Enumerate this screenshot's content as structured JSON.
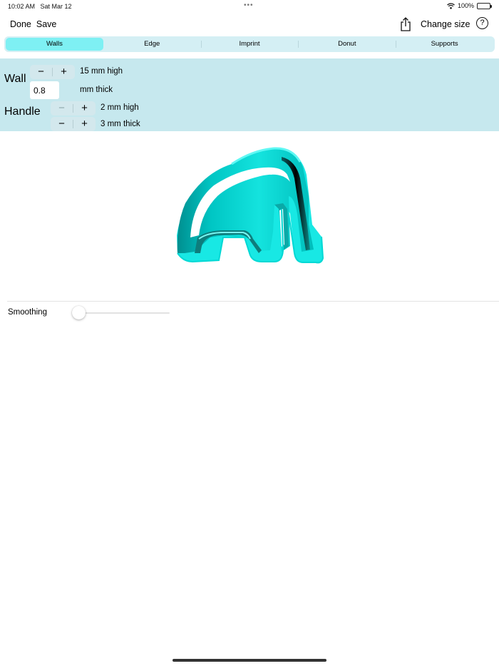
{
  "status_bar": {
    "time": "10:02 AM",
    "date": "Sat Mar 12",
    "dots": "•••",
    "battery": "100%",
    "battery_level": 1.0
  },
  "nav": {
    "done_label": "Done",
    "save_label": "Save",
    "change_size_label": "Change size",
    "help_label": "?"
  },
  "tabs": [
    {
      "label": "Walls",
      "active": true
    },
    {
      "label": "Edge",
      "active": false
    },
    {
      "label": "Imprint",
      "active": false
    },
    {
      "label": "Donut",
      "active": false
    },
    {
      "label": "Supports",
      "active": false
    }
  ],
  "wall": {
    "label": "Wall",
    "minus": "−",
    "plus": "+",
    "height_text": "15 mm high",
    "thickness_value": "0.8",
    "thickness_unit": "mm thick"
  },
  "handle": {
    "label": "Handle",
    "minus": "−",
    "plus": "+",
    "height_text": "2 mm high",
    "thickness_text": "3 mm thick"
  },
  "smoothing": {
    "label": "Smoothing",
    "value": 0.0
  },
  "colors": {
    "accent": "#7ef0f3",
    "panel": "#c6e8ee",
    "model": "#00e5e0"
  }
}
